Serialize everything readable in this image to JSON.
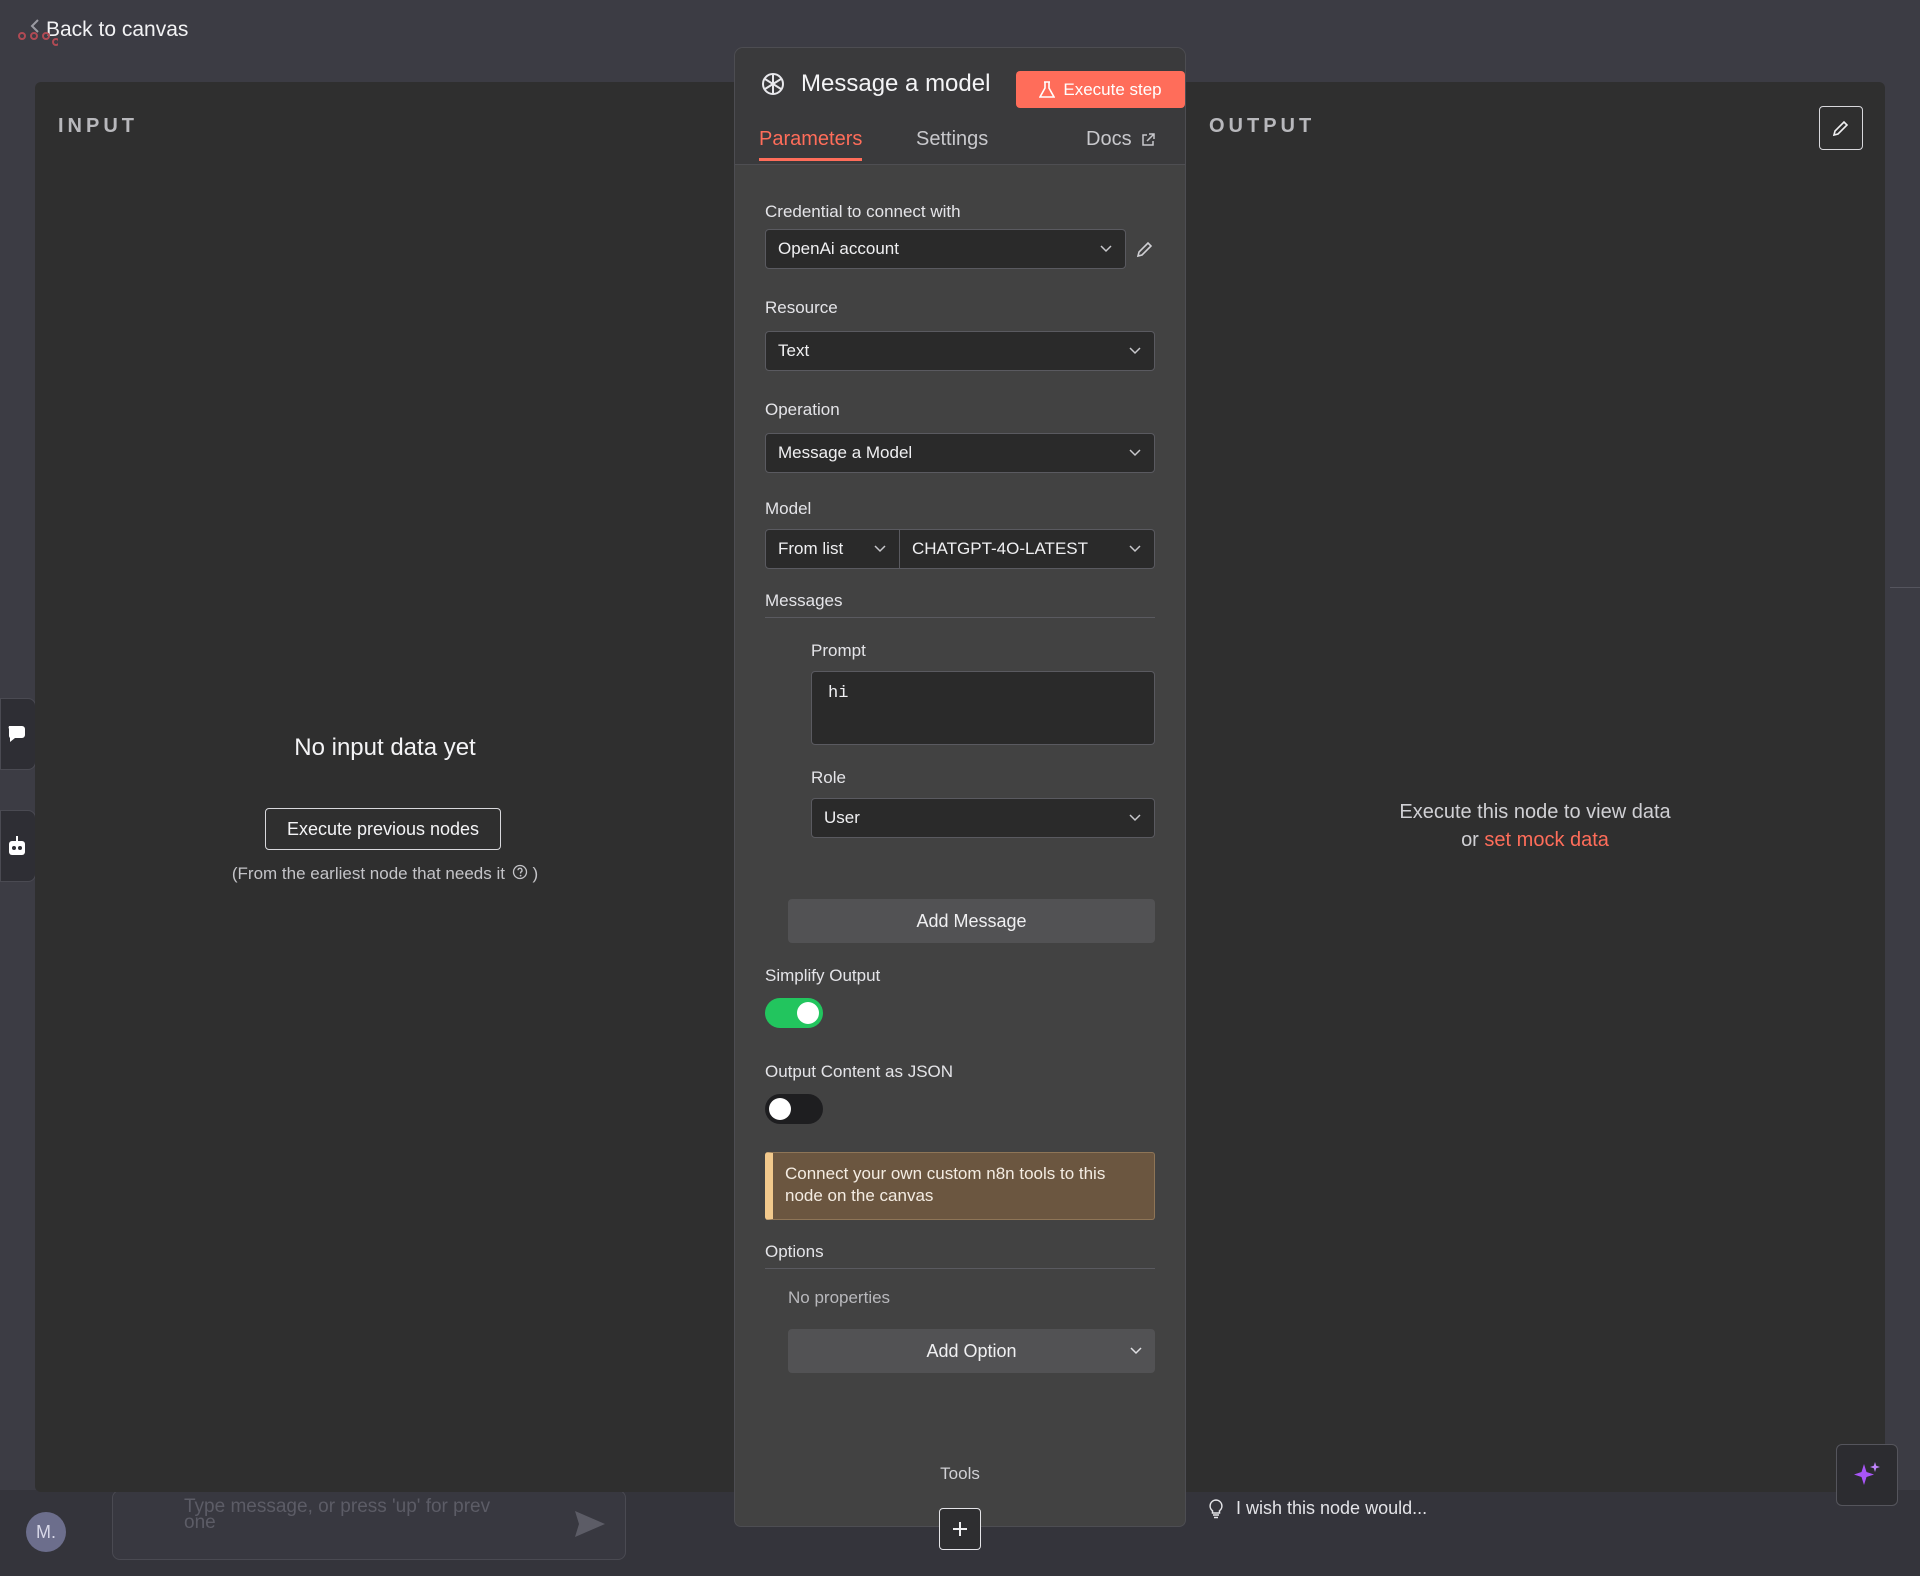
{
  "nav": {
    "back_label": "Back to canvas"
  },
  "input_panel": {
    "heading": "INPUT",
    "empty_title": "No input data yet",
    "execute_prev_label": "Execute previous nodes",
    "hint": "(From the earliest node that needs it",
    "hint_close": ")"
  },
  "output_panel": {
    "heading": "OUTPUT",
    "message_line1": "Execute this node to view data",
    "message_or": "or",
    "mock_link": "set mock data"
  },
  "node": {
    "title": "Message a model",
    "execute_label": "Execute step",
    "tabs": {
      "parameters": "Parameters",
      "settings": "Settings",
      "docs": "Docs"
    },
    "credential": {
      "label": "Credential to connect with",
      "value": "OpenAi account"
    },
    "resource": {
      "label": "Resource",
      "value": "Text"
    },
    "operation": {
      "label": "Operation",
      "value": "Message a Model"
    },
    "model": {
      "label": "Model",
      "mode": "From list",
      "value": "CHATGPT-4O-LATEST"
    },
    "messages": {
      "label": "Messages",
      "prompt_label": "Prompt",
      "prompt_value": "hi",
      "role_label": "Role",
      "role_value": "User",
      "add_label": "Add Message"
    },
    "simplify": {
      "label": "Simplify Output",
      "on": true
    },
    "json_output": {
      "label": "Output Content as JSON",
      "on": false
    },
    "callout": "Connect your own custom n8n tools to this node on the canvas",
    "options": {
      "label": "Options",
      "empty": "No properties",
      "add_label": "Add Option"
    },
    "tools_label": "Tools"
  },
  "footer": {
    "wish_text": "I wish this node would...",
    "chat_placeholder_1": "Type message, or press 'up' for prev",
    "chat_placeholder_2": "one",
    "avatar_initials": "M."
  },
  "colors": {
    "accent": "#ff6d5a",
    "toggle_on": "#22c55e",
    "callout_bg": "#6b5640",
    "callout_border": "#f2c98c",
    "sparkle": "#a855f7"
  },
  "icons": [
    "arrow-left-icon",
    "workflow-icon",
    "openai-icon",
    "flask-icon",
    "external-link-icon",
    "pencil-icon",
    "chevron-down-icon",
    "question-circle-icon",
    "lightbulb-icon",
    "plus-icon",
    "sparkle-icon",
    "chat-icon",
    "robot-icon",
    "send-icon"
  ]
}
